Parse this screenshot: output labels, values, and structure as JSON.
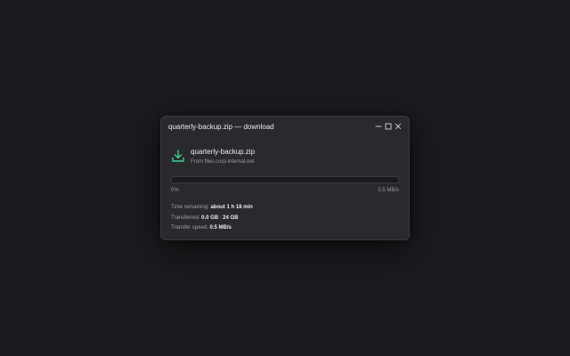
{
  "window": {
    "title": "quarterly-backup.zip — download",
    "controls": {
      "minimize": "minimize-icon",
      "maximize": "maximize-icon",
      "close": "close-icon"
    }
  },
  "file": {
    "icon": "download-icon",
    "name": "quarterly-backup.zip",
    "source": "From files.corp-internal.net"
  },
  "progress": {
    "percent_label": "0%",
    "speed_label": "0.5 MB/s",
    "fraction": 0,
    "color": "#3ecf8e"
  },
  "stats": {
    "time_remaining_label": "Time remaining:",
    "time_remaining_value": "about 1 h 18 min",
    "transferred_label": "Transferred:",
    "transferred_value": "0.0 GB",
    "transferred_separator": "/",
    "transferred_total": "24 GB",
    "speed_label": "Transfer speed:",
    "speed_value": "0.5 MB/s"
  }
}
